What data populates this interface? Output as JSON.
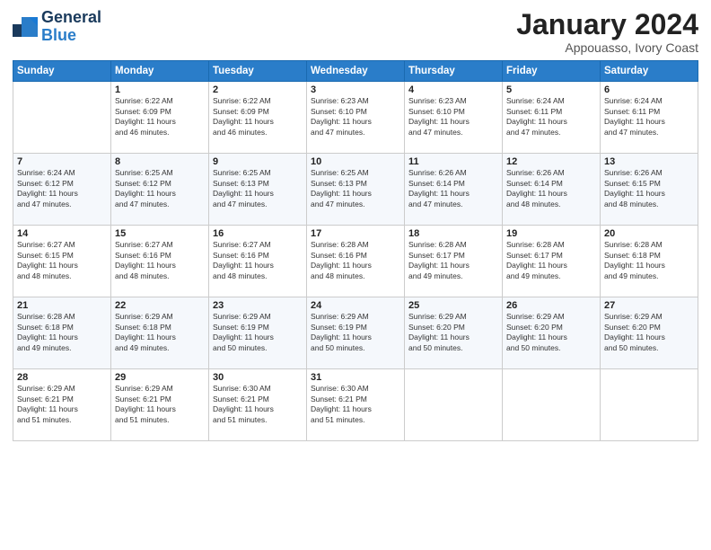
{
  "header": {
    "logo_general": "General",
    "logo_blue": "Blue",
    "month_title": "January 2024",
    "location": "Appouasso, Ivory Coast"
  },
  "days_of_week": [
    "Sunday",
    "Monday",
    "Tuesday",
    "Wednesday",
    "Thursday",
    "Friday",
    "Saturday"
  ],
  "weeks": [
    [
      {
        "day": "",
        "info": ""
      },
      {
        "day": "1",
        "info": "Sunrise: 6:22 AM\nSunset: 6:09 PM\nDaylight: 11 hours\nand 46 minutes."
      },
      {
        "day": "2",
        "info": "Sunrise: 6:22 AM\nSunset: 6:09 PM\nDaylight: 11 hours\nand 46 minutes."
      },
      {
        "day": "3",
        "info": "Sunrise: 6:23 AM\nSunset: 6:10 PM\nDaylight: 11 hours\nand 47 minutes."
      },
      {
        "day": "4",
        "info": "Sunrise: 6:23 AM\nSunset: 6:10 PM\nDaylight: 11 hours\nand 47 minutes."
      },
      {
        "day": "5",
        "info": "Sunrise: 6:24 AM\nSunset: 6:11 PM\nDaylight: 11 hours\nand 47 minutes."
      },
      {
        "day": "6",
        "info": "Sunrise: 6:24 AM\nSunset: 6:11 PM\nDaylight: 11 hours\nand 47 minutes."
      }
    ],
    [
      {
        "day": "7",
        "info": "Sunrise: 6:24 AM\nSunset: 6:12 PM\nDaylight: 11 hours\nand 47 minutes."
      },
      {
        "day": "8",
        "info": "Sunrise: 6:25 AM\nSunset: 6:12 PM\nDaylight: 11 hours\nand 47 minutes."
      },
      {
        "day": "9",
        "info": "Sunrise: 6:25 AM\nSunset: 6:13 PM\nDaylight: 11 hours\nand 47 minutes."
      },
      {
        "day": "10",
        "info": "Sunrise: 6:25 AM\nSunset: 6:13 PM\nDaylight: 11 hours\nand 47 minutes."
      },
      {
        "day": "11",
        "info": "Sunrise: 6:26 AM\nSunset: 6:14 PM\nDaylight: 11 hours\nand 47 minutes."
      },
      {
        "day": "12",
        "info": "Sunrise: 6:26 AM\nSunset: 6:14 PM\nDaylight: 11 hours\nand 48 minutes."
      },
      {
        "day": "13",
        "info": "Sunrise: 6:26 AM\nSunset: 6:15 PM\nDaylight: 11 hours\nand 48 minutes."
      }
    ],
    [
      {
        "day": "14",
        "info": "Sunrise: 6:27 AM\nSunset: 6:15 PM\nDaylight: 11 hours\nand 48 minutes."
      },
      {
        "day": "15",
        "info": "Sunrise: 6:27 AM\nSunset: 6:16 PM\nDaylight: 11 hours\nand 48 minutes."
      },
      {
        "day": "16",
        "info": "Sunrise: 6:27 AM\nSunset: 6:16 PM\nDaylight: 11 hours\nand 48 minutes."
      },
      {
        "day": "17",
        "info": "Sunrise: 6:28 AM\nSunset: 6:16 PM\nDaylight: 11 hours\nand 48 minutes."
      },
      {
        "day": "18",
        "info": "Sunrise: 6:28 AM\nSunset: 6:17 PM\nDaylight: 11 hours\nand 49 minutes."
      },
      {
        "day": "19",
        "info": "Sunrise: 6:28 AM\nSunset: 6:17 PM\nDaylight: 11 hours\nand 49 minutes."
      },
      {
        "day": "20",
        "info": "Sunrise: 6:28 AM\nSunset: 6:18 PM\nDaylight: 11 hours\nand 49 minutes."
      }
    ],
    [
      {
        "day": "21",
        "info": "Sunrise: 6:28 AM\nSunset: 6:18 PM\nDaylight: 11 hours\nand 49 minutes."
      },
      {
        "day": "22",
        "info": "Sunrise: 6:29 AM\nSunset: 6:18 PM\nDaylight: 11 hours\nand 49 minutes."
      },
      {
        "day": "23",
        "info": "Sunrise: 6:29 AM\nSunset: 6:19 PM\nDaylight: 11 hours\nand 50 minutes."
      },
      {
        "day": "24",
        "info": "Sunrise: 6:29 AM\nSunset: 6:19 PM\nDaylight: 11 hours\nand 50 minutes."
      },
      {
        "day": "25",
        "info": "Sunrise: 6:29 AM\nSunset: 6:20 PM\nDaylight: 11 hours\nand 50 minutes."
      },
      {
        "day": "26",
        "info": "Sunrise: 6:29 AM\nSunset: 6:20 PM\nDaylight: 11 hours\nand 50 minutes."
      },
      {
        "day": "27",
        "info": "Sunrise: 6:29 AM\nSunset: 6:20 PM\nDaylight: 11 hours\nand 50 minutes."
      }
    ],
    [
      {
        "day": "28",
        "info": "Sunrise: 6:29 AM\nSunset: 6:21 PM\nDaylight: 11 hours\nand 51 minutes."
      },
      {
        "day": "29",
        "info": "Sunrise: 6:29 AM\nSunset: 6:21 PM\nDaylight: 11 hours\nand 51 minutes."
      },
      {
        "day": "30",
        "info": "Sunrise: 6:30 AM\nSunset: 6:21 PM\nDaylight: 11 hours\nand 51 minutes."
      },
      {
        "day": "31",
        "info": "Sunrise: 6:30 AM\nSunset: 6:21 PM\nDaylight: 11 hours\nand 51 minutes."
      },
      {
        "day": "",
        "info": ""
      },
      {
        "day": "",
        "info": ""
      },
      {
        "day": "",
        "info": ""
      }
    ]
  ]
}
